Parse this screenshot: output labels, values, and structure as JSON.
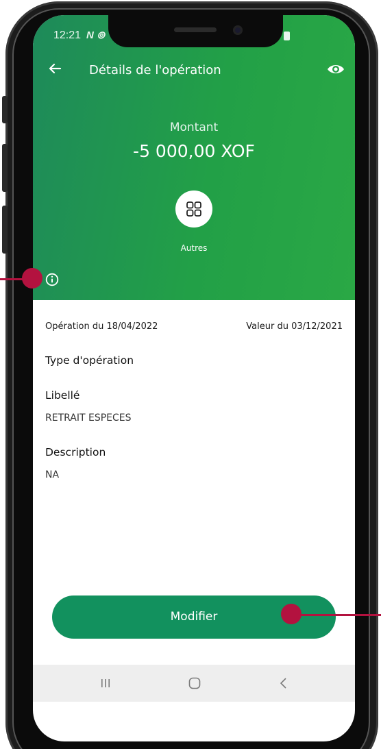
{
  "status_bar": {
    "time": "12:21",
    "icons_text": "N ⊚"
  },
  "header": {
    "title": "Détails de l'opération",
    "amount_label": "Montant",
    "amount_value": "-5 000,00 XOF",
    "category_label": "Autres",
    "gradient_start": "#1e8a5a",
    "gradient_end": "#2aa845"
  },
  "details": {
    "operation_date": "Opération du 18/04/2022",
    "value_date": "Valeur du 03/12/2021",
    "type_label": "Type d'opération",
    "libelle_label": "Libellé",
    "libelle_value": "RETRAIT ESPECES",
    "description_label": "Description",
    "description_value": "NA"
  },
  "actions": {
    "modify_label": "Modifier",
    "button_color": "#12915e"
  },
  "icons": {
    "back": "arrow-left-icon",
    "eye": "eye-icon",
    "category": "grid-icon",
    "info": "info-icon",
    "nav_recent": "recent-apps-icon",
    "nav_home": "home-icon",
    "nav_back": "chevron-left-icon"
  },
  "annotation_color": "#b3123f"
}
